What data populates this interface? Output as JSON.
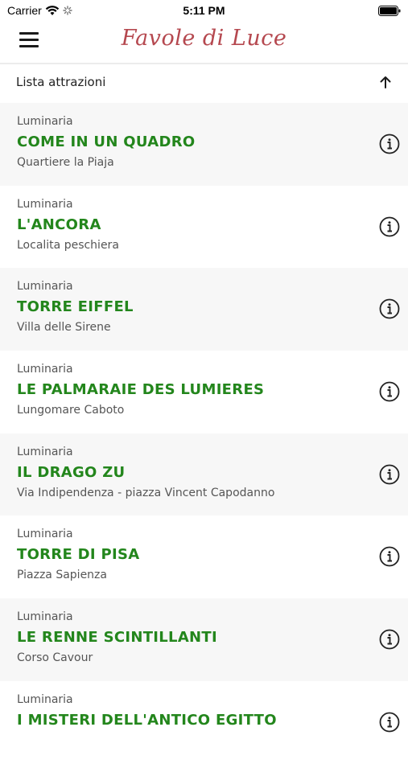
{
  "status_bar": {
    "carrier": "Carrier",
    "time": "5:11 PM"
  },
  "header": {
    "logo_text": "Favole di Luce"
  },
  "list_header": {
    "title": "Lista attrazioni"
  },
  "items": [
    {
      "category": "Luminaria",
      "title": "COME IN UN QUADRO",
      "location": "Quartiere la Piaja"
    },
    {
      "category": "Luminaria",
      "title": "L'ANCORA",
      "location": "Localita peschiera"
    },
    {
      "category": "Luminaria",
      "title": "TORRE EIFFEL",
      "location": "Villa delle Sirene"
    },
    {
      "category": "Luminaria",
      "title": "LE PALMARAIE DES LUMIERES",
      "location": "Lungomare Caboto"
    },
    {
      "category": "Luminaria",
      "title": "IL DRAGO ZU",
      "location": "Via Indipendenza - piazza Vincent Capodanno"
    },
    {
      "category": "Luminaria",
      "title": "TORRE DI PISA",
      "location": "Piazza Sapienza"
    },
    {
      "category": "Luminaria",
      "title": "LE RENNE SCINTILLANTI",
      "location": "Corso Cavour"
    },
    {
      "category": "Luminaria",
      "title": "I MISTERI DELL'ANTICO EGITTO",
      "location": ""
    }
  ],
  "colors": {
    "title_green": "#23861c",
    "logo_red": "#b5484f",
    "alt_row": "#f7f7f7"
  },
  "icons": {
    "menu": "hamburger-menu-icon",
    "arrow": "arrow-up-icon",
    "info": "info-icon"
  }
}
